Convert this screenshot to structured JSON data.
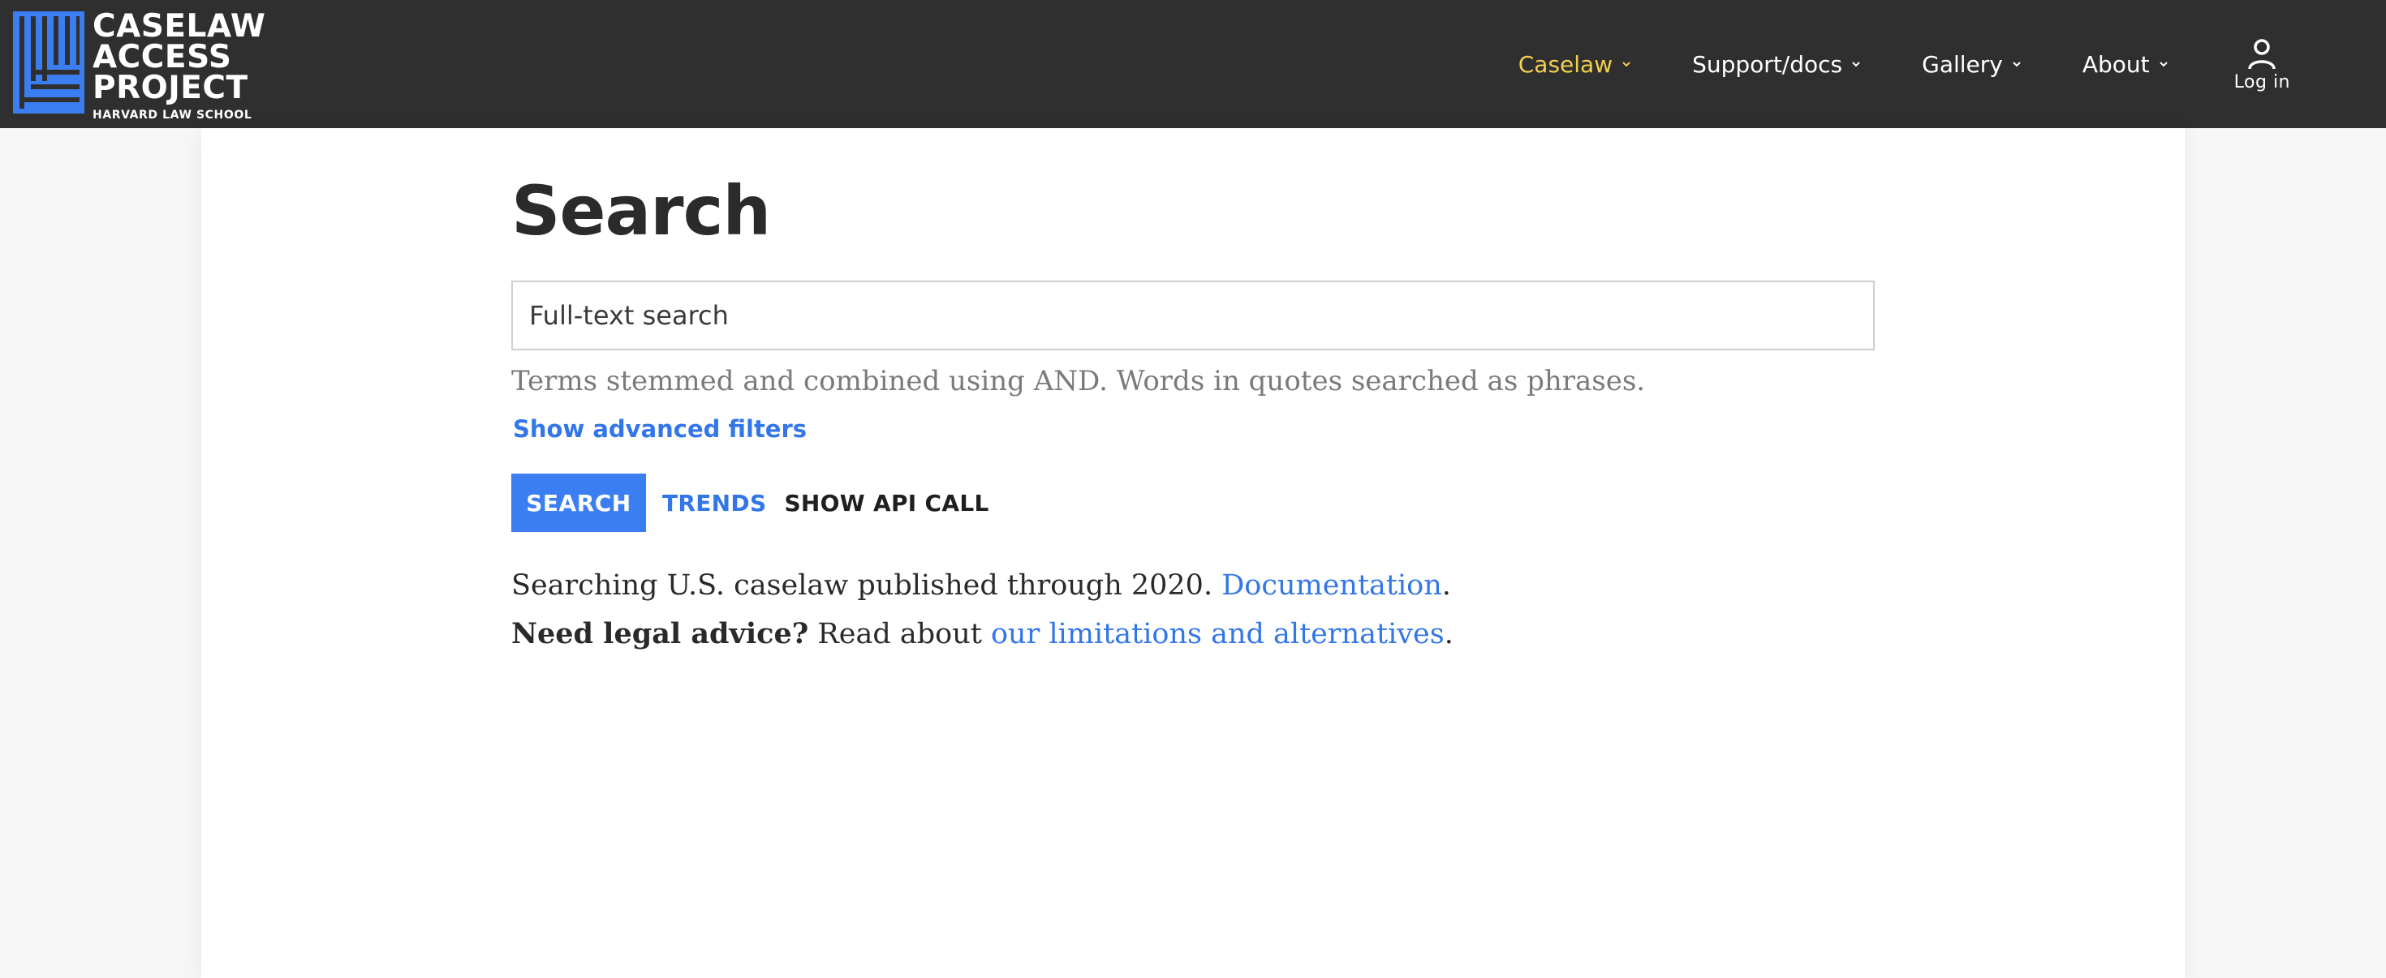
{
  "header": {
    "logo": {
      "line1": "CASELAW",
      "line2": "ACCESS",
      "line3": "PROJECT",
      "subtitle": "HARVARD LAW SCHOOL",
      "mark_color": "#3b7ef2"
    },
    "nav": [
      {
        "label": "Caselaw",
        "active": true,
        "icon": "chevron-down-icon"
      },
      {
        "label": "Support/docs",
        "active": false,
        "icon": "chevron-down-icon"
      },
      {
        "label": "Gallery",
        "active": false,
        "icon": "chevron-down-icon"
      },
      {
        "label": "About",
        "active": false,
        "icon": "chevron-down-icon"
      }
    ],
    "login": {
      "label": "Log in",
      "icon": "user-icon"
    },
    "colors": {
      "background": "#2f2f2f",
      "active_nav": "#f3cf4f"
    }
  },
  "main": {
    "title": "Search",
    "search": {
      "value": "",
      "placeholder": "Full-text search"
    },
    "hint": "Terms stemmed and combined using AND. Words in quotes searched as phrases.",
    "advanced_filters_label": "Show advanced filters",
    "actions": {
      "search_label": "SEARCH",
      "trends_label": "TRENDS",
      "api_label": "SHOW API CALL"
    },
    "info": {
      "line1_text": "Searching U.S. caselaw published through 2020.",
      "line1_link": "Documentation",
      "line1_end": ".",
      "line2_bold": "Need legal advice?",
      "line2_text": "Read about",
      "line2_link": "our limitations and alternatives",
      "line2_end": "."
    },
    "colors": {
      "accent": "#3b7ef2",
      "link": "#3276e8"
    }
  }
}
